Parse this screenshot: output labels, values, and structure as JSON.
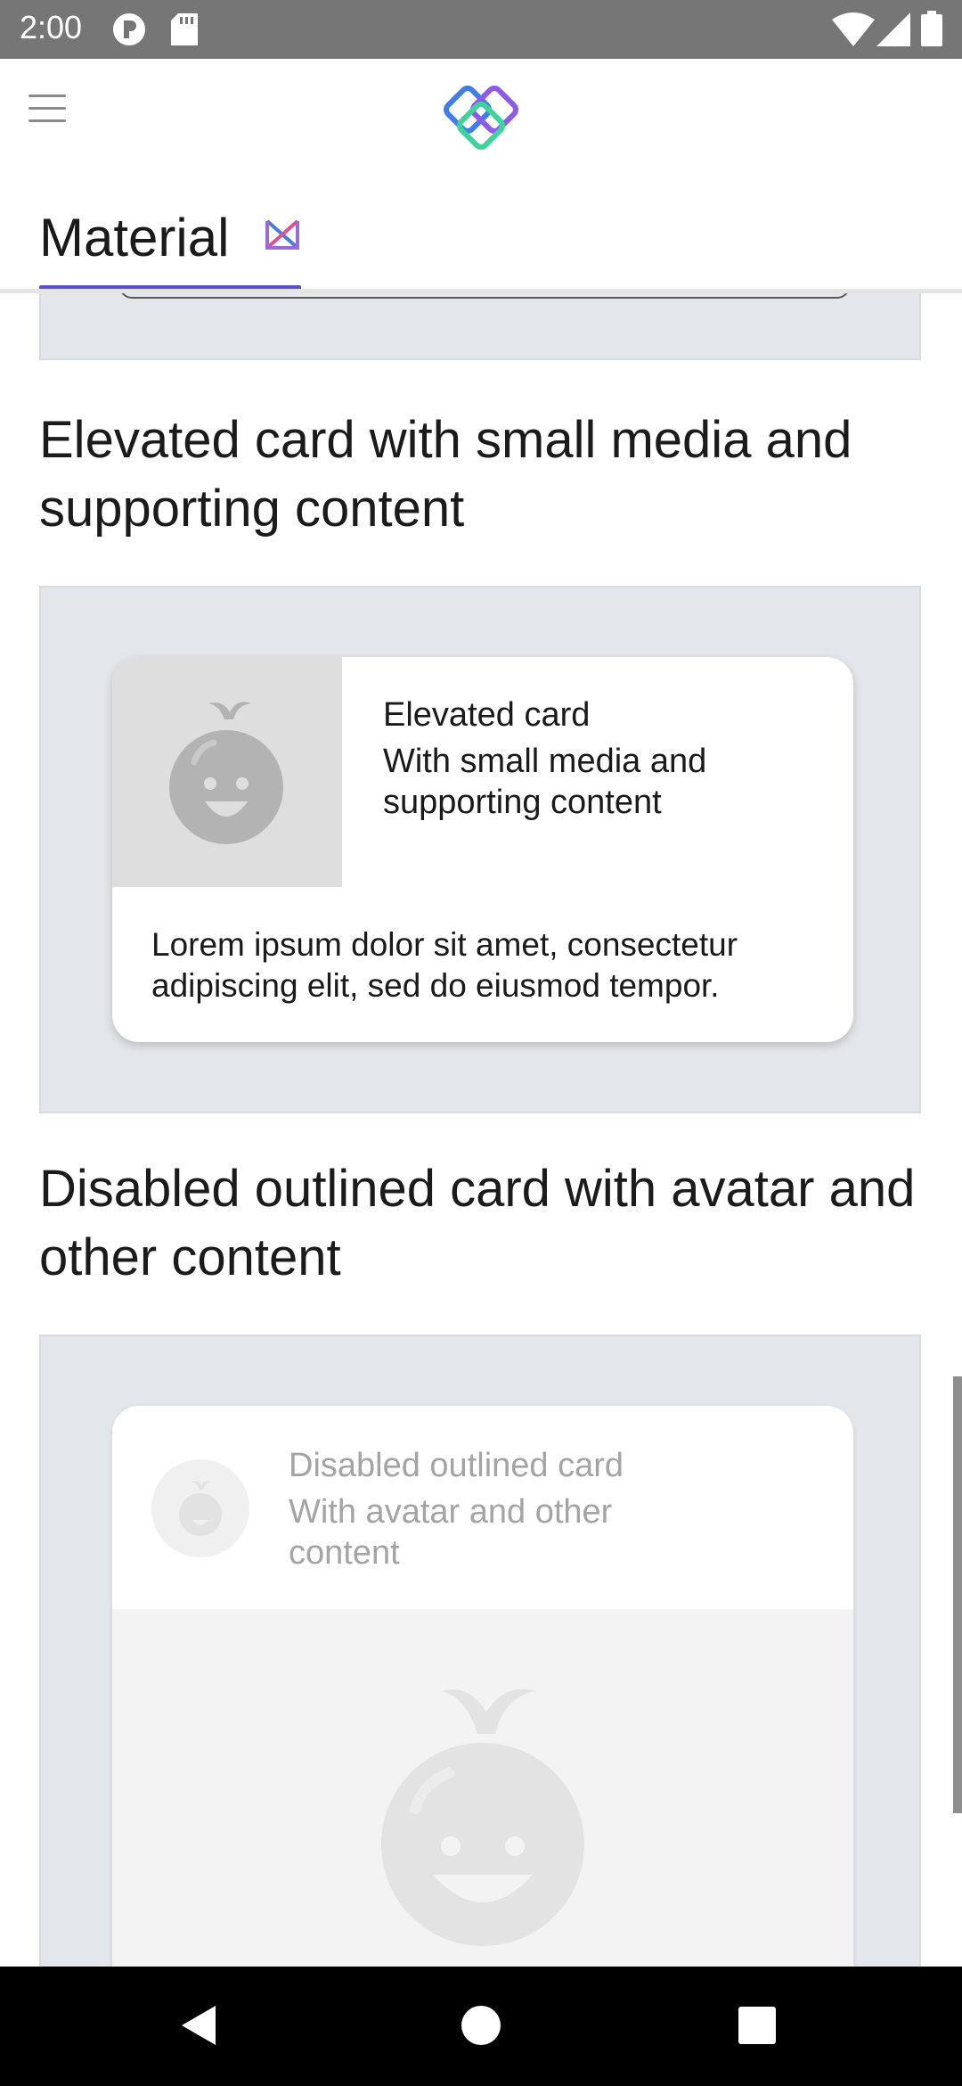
{
  "status_bar": {
    "time": "2:00"
  },
  "app_bar": {
    "tab_label": "Material"
  },
  "sections": [
    {
      "title": "Elevated card with small media and supporting content",
      "card": {
        "title": "Elevated card",
        "subtitle": "With small media and supporting content",
        "body": "Lorem ipsum dolor sit amet, consectetur adipiscing elit, sed do eiusmod tempor."
      }
    },
    {
      "title": "Disabled outlined card with avatar and other content",
      "card": {
        "title": "Disabled outlined card",
        "subtitle": "With avatar and other content"
      }
    }
  ],
  "colors": {
    "tab_indicator": "#5b4fd8",
    "demo_background": "#e3e6ea",
    "status_bar": "#767676"
  },
  "icons": [
    "menu-icon",
    "app-logo-icon",
    "material-icon",
    "back-icon",
    "home-icon",
    "recents-icon"
  ]
}
